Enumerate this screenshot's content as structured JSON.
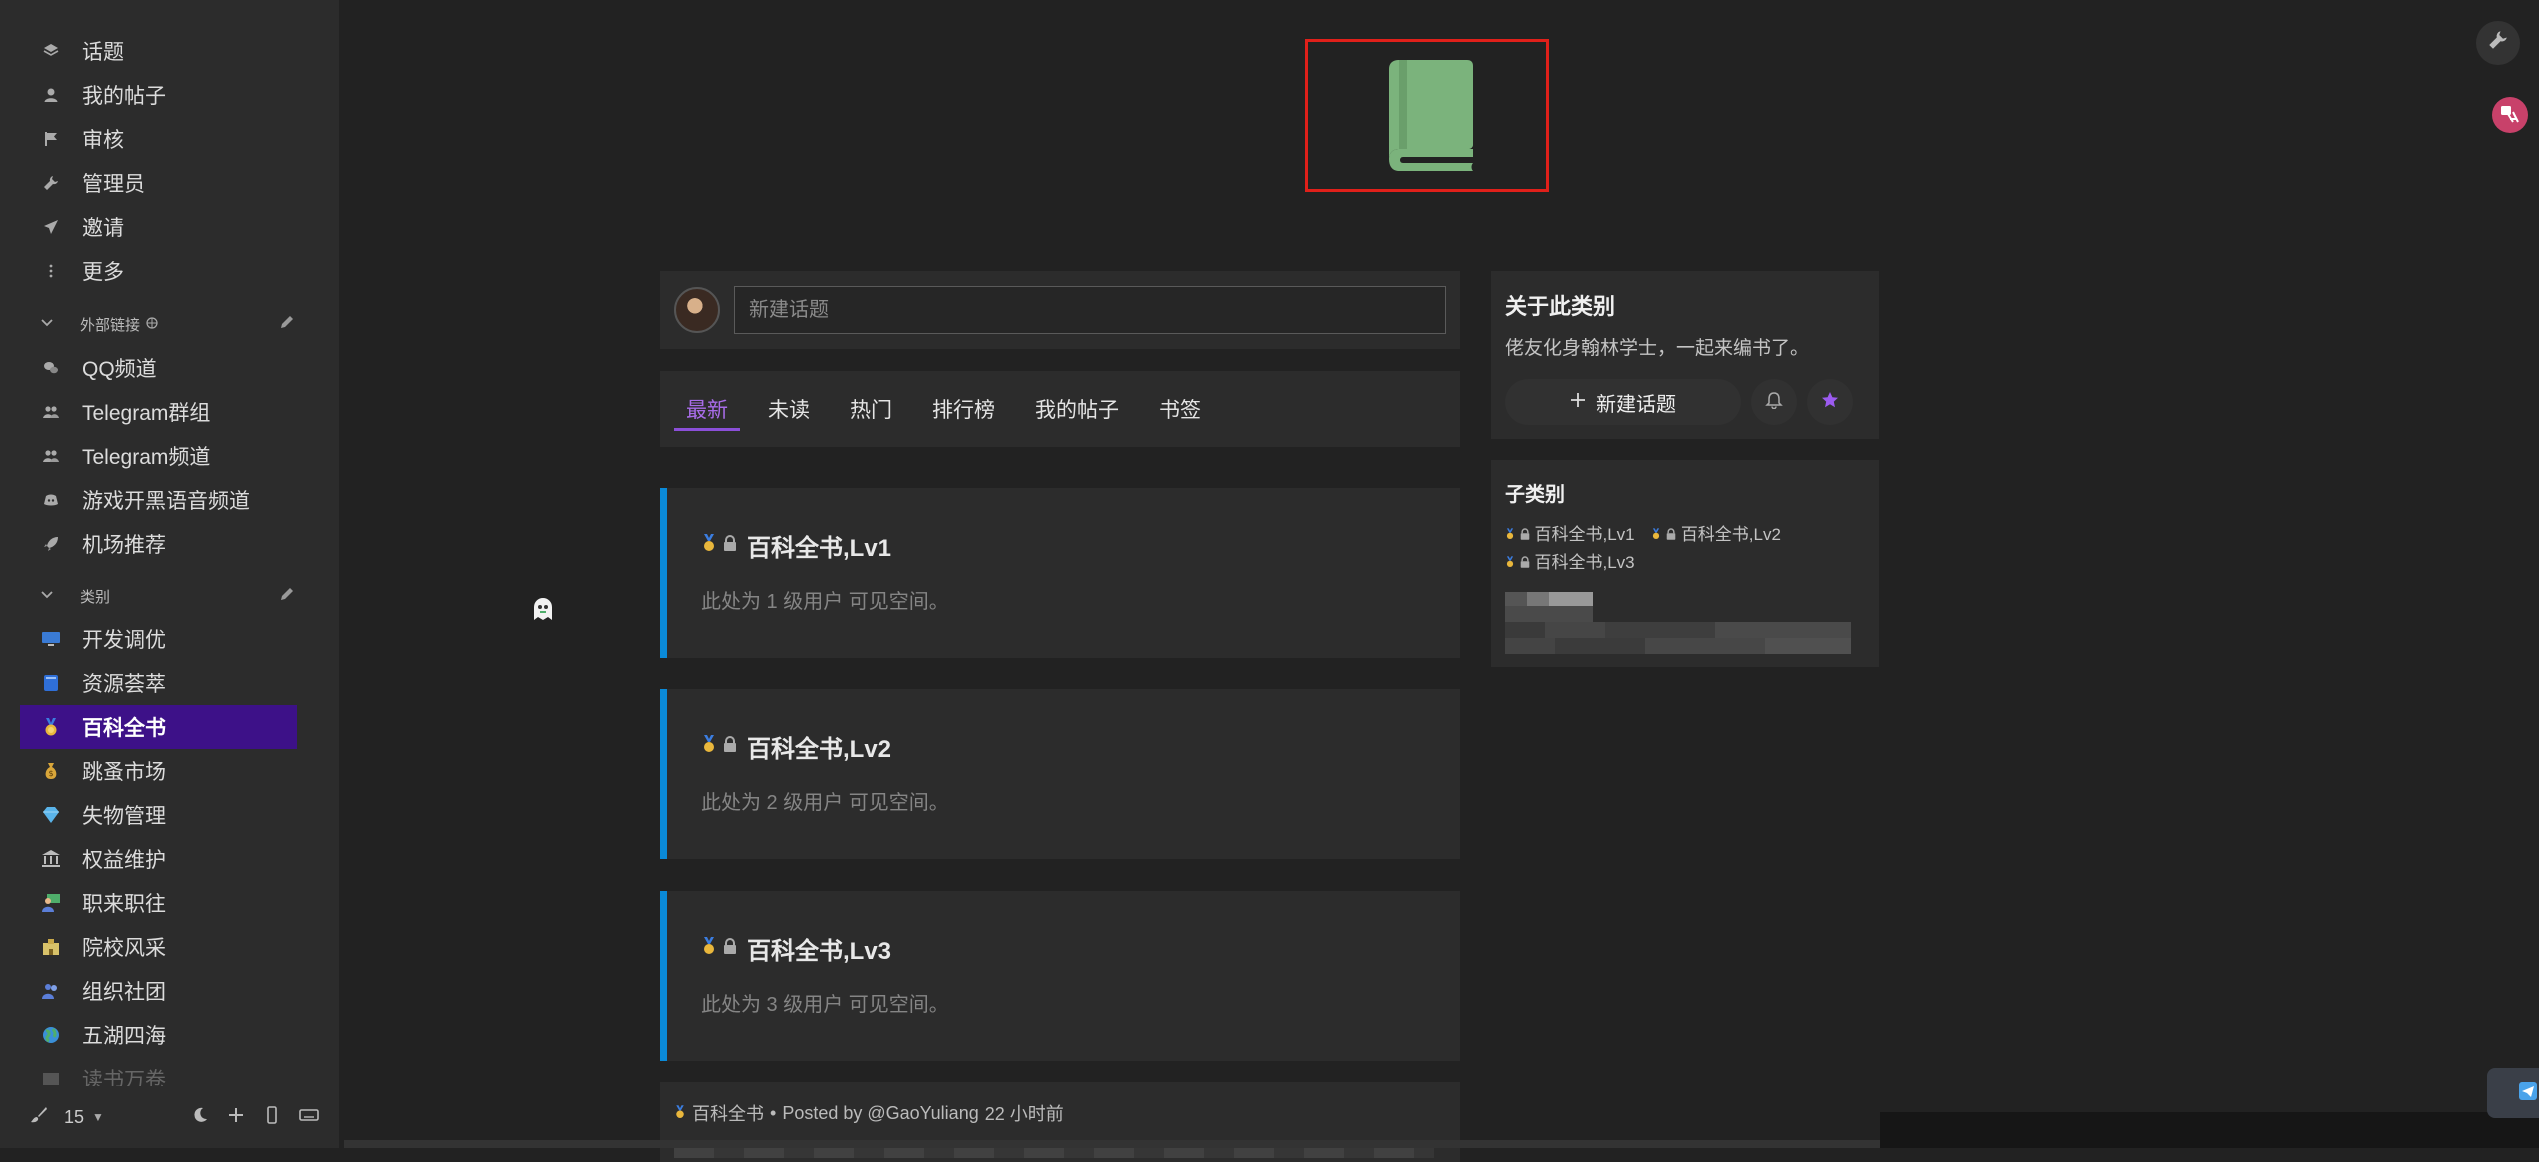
{
  "sidebar": {
    "nav": [
      {
        "label": "话题",
        "icon": "layers-icon"
      },
      {
        "label": "我的帖子",
        "icon": "user-icon"
      },
      {
        "label": "审核",
        "icon": "flag-icon"
      },
      {
        "label": "管理员",
        "icon": "wrench-icon"
      },
      {
        "label": "邀请",
        "icon": "paper-plane-icon"
      },
      {
        "label": "更多",
        "icon": "more-vertical-icon"
      }
    ],
    "external_section": {
      "title": "外部链接"
    },
    "external_links": [
      {
        "label": "QQ频道",
        "icon": "comments-icon"
      },
      {
        "label": "Telegram群组",
        "icon": "users-icon"
      },
      {
        "label": "Telegram频道",
        "icon": "users-icon"
      },
      {
        "label": "游戏开黑语音频道",
        "icon": "discord-icon"
      },
      {
        "label": "机场推荐",
        "icon": "rocket-icon"
      }
    ],
    "categories_section": {
      "title": "类别"
    },
    "categories": [
      {
        "label": "开发调优",
        "icon": "computer-icon",
        "color": "#3a7bd5"
      },
      {
        "label": "资源荟萃",
        "icon": "book-icon",
        "color": "#2f6fd8"
      },
      {
        "label": "百科全书",
        "icon": "medal-icon",
        "color": "#e9b73c"
      },
      {
        "label": "跳蚤市场",
        "icon": "money-bag-icon",
        "color": "#d9a63a"
      },
      {
        "label": "失物管理",
        "icon": "gem-icon",
        "color": "#5ab4ea"
      },
      {
        "label": "权益维护",
        "icon": "bank-icon",
        "color": "#bbbbbb"
      },
      {
        "label": "职来职往",
        "icon": "teacher-icon",
        "color": "#d08b5b"
      },
      {
        "label": "院校风采",
        "icon": "school-icon",
        "color": "#d8c26a"
      },
      {
        "label": "组织社团",
        "icon": "group-icon",
        "color": "#5b7ed8"
      },
      {
        "label": "五湖四海",
        "icon": "globe-icon",
        "color": "#4fae6b"
      },
      {
        "label": "读书万卷",
        "icon": "books-icon",
        "color": "#777777"
      }
    ],
    "active_category": "百科全书",
    "footer": {
      "count": "15"
    }
  },
  "composer": {
    "placeholder": "新建话题"
  },
  "tabs": [
    {
      "label": "最新",
      "active": true
    },
    {
      "label": "未读",
      "active": false
    },
    {
      "label": "热门",
      "active": false
    },
    {
      "label": "排行榜",
      "active": false
    },
    {
      "label": "我的帖子",
      "active": false
    },
    {
      "label": "书签",
      "active": false
    }
  ],
  "cards": [
    {
      "title": "百科全书,Lv1",
      "desc": "此处为 1 级用户 可见空间。"
    },
    {
      "title": "百科全书,Lv2",
      "desc": "此处为 2 级用户 可见空间。"
    },
    {
      "title": "百科全书,Lv3",
      "desc": "此处为 3 级用户 可见空间。"
    }
  ],
  "post_preview": {
    "category": "百科全书",
    "separator": "•",
    "posted_by": "Posted by @GaoYuliang",
    "time": "22 小时前"
  },
  "about": {
    "title": "关于此类别",
    "desc": "佬友化身翰林学士，一起来编书了。",
    "new_topic": "新建话题"
  },
  "subcategories": {
    "title": "子类别",
    "items": [
      "百科全书,Lv1",
      "百科全书,Lv2",
      "百科全书,Lv3"
    ]
  },
  "colors": {
    "accent": "#8b4fd8",
    "active_bg": "#3d1188",
    "card_border": "#0a8ad8",
    "logo_green": "#7bb37c",
    "highlight_box": "#e0201a"
  }
}
